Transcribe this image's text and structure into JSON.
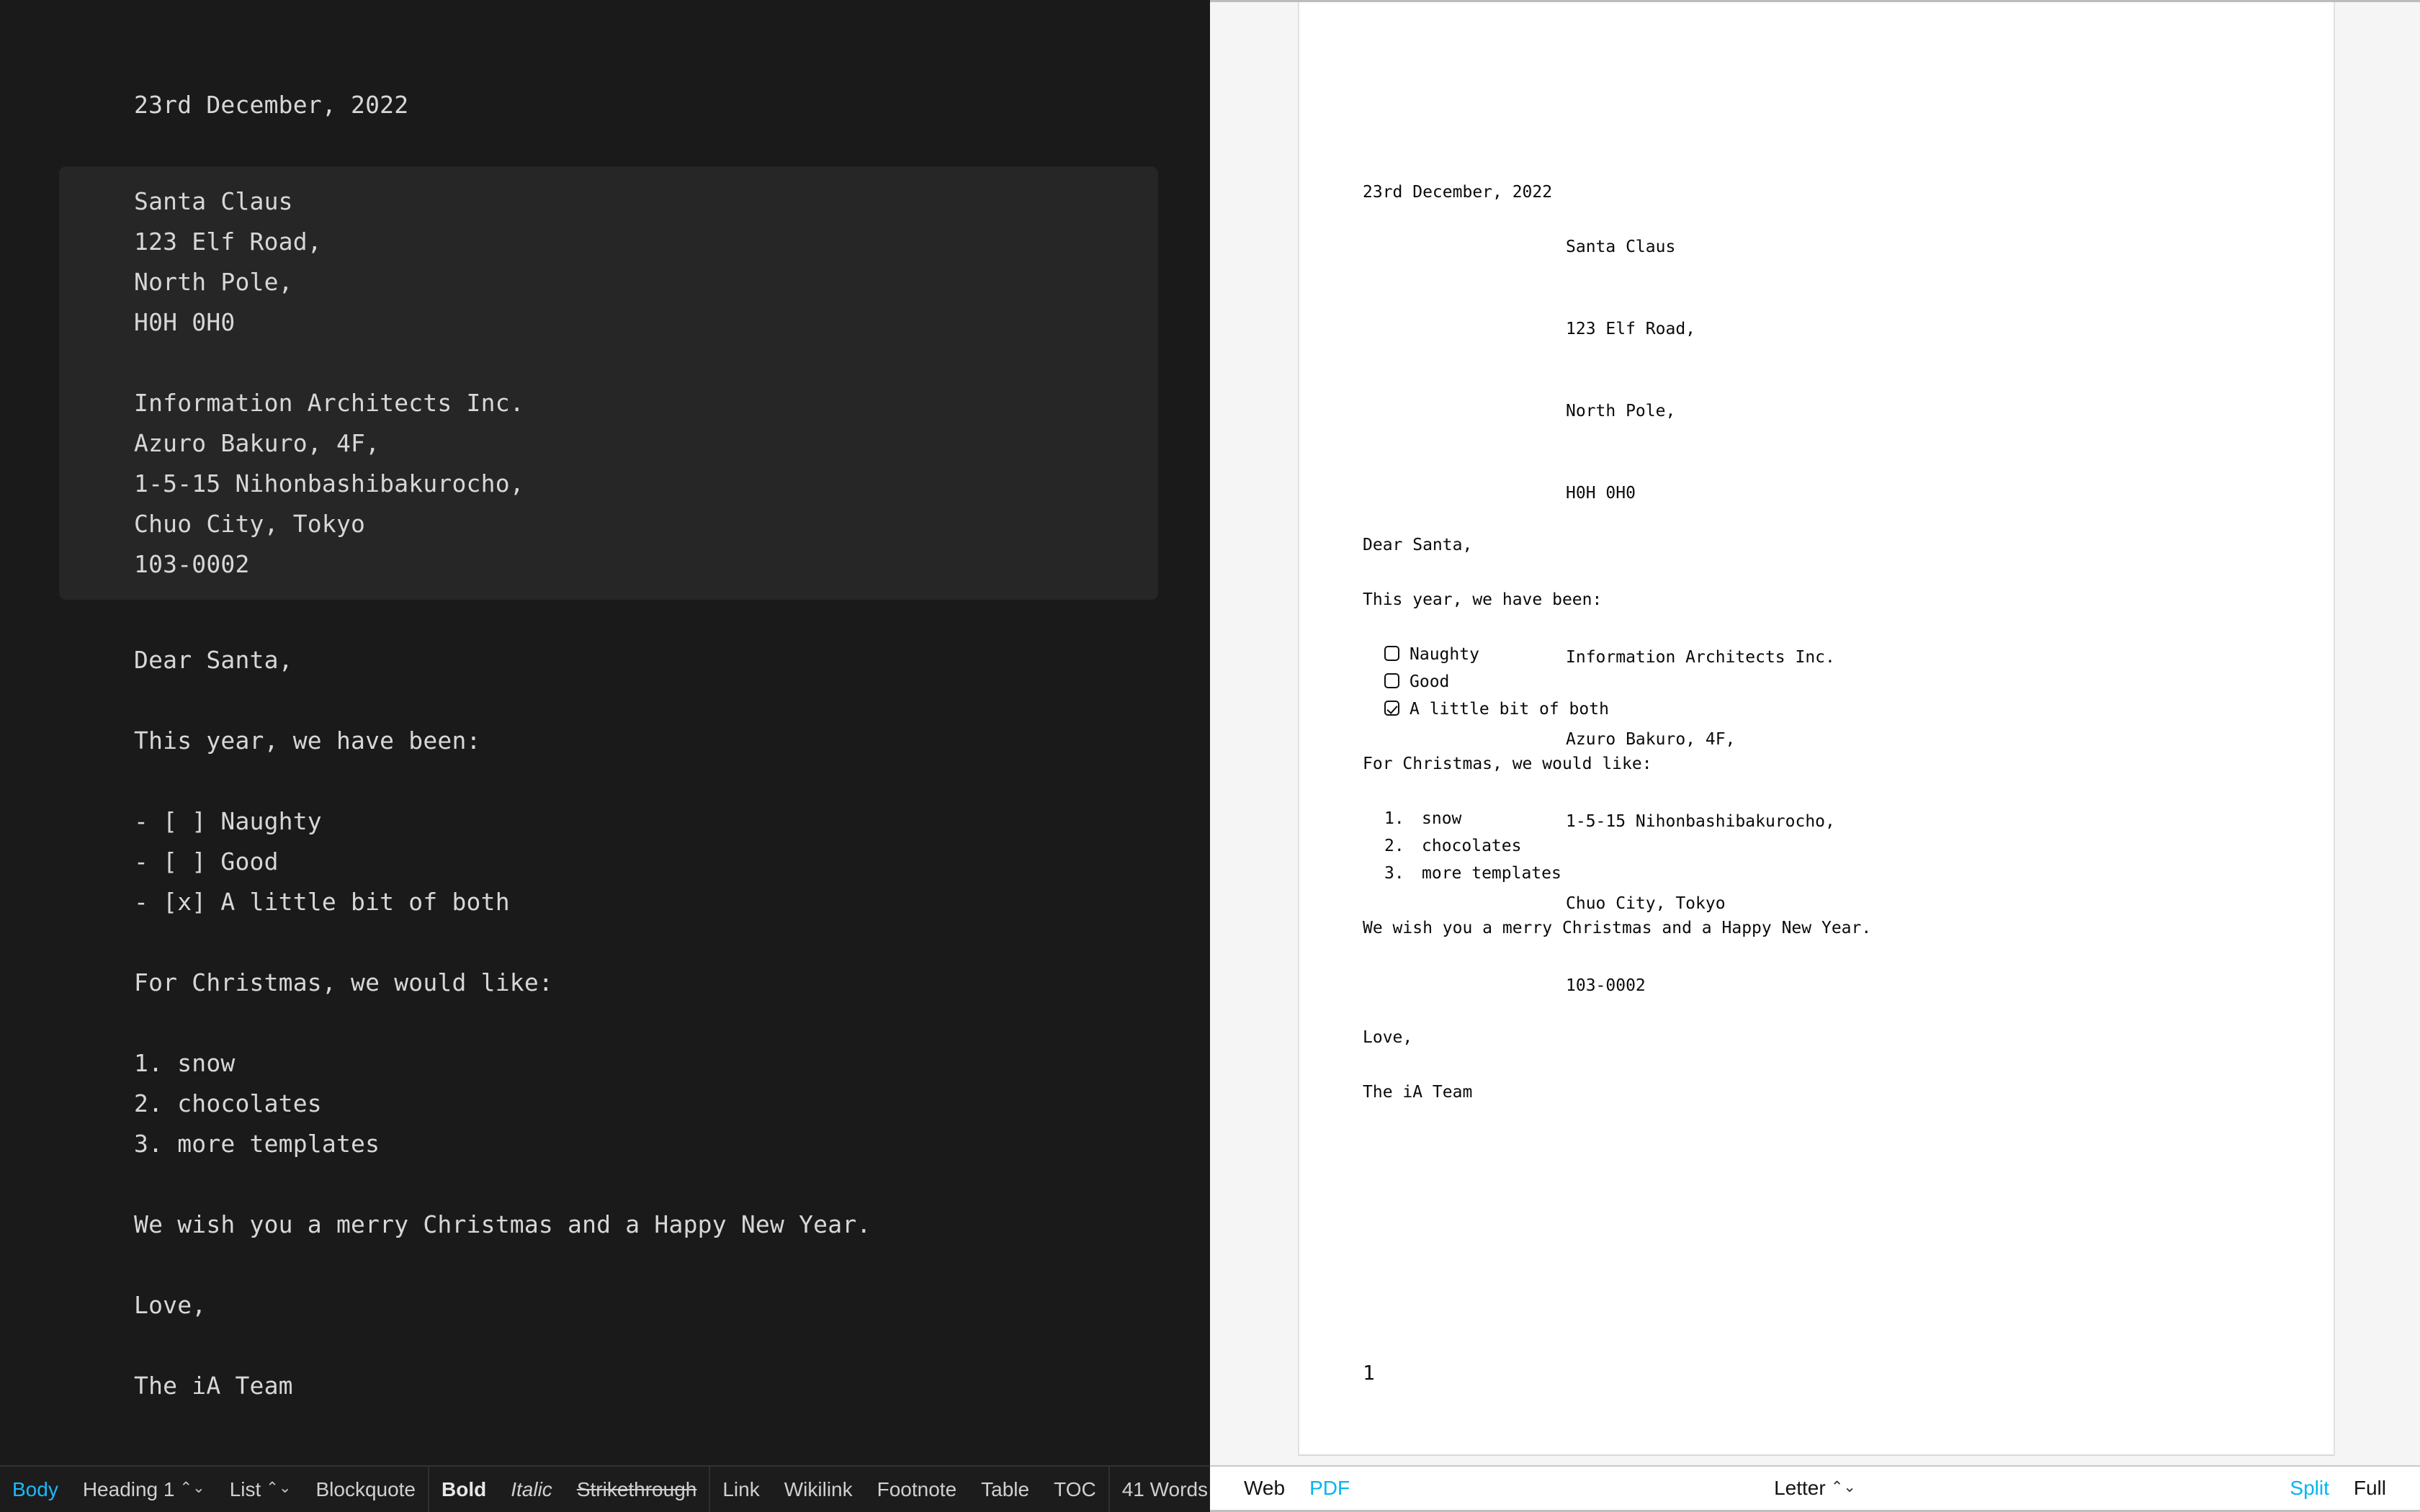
{
  "editor": {
    "date_line": "23rd December, 2022",
    "address_block": [
      "Santa Claus",
      "123 Elf Road,",
      "North Pole,",
      "H0H 0H0",
      "",
      "Information Architects Inc.",
      "Azuro Bakuro, 4F,",
      "1-5-15 Nihonbashibakurocho,",
      "Chuo City, Tokyo",
      "103-0002"
    ],
    "body_lines": [
      "Dear Santa,",
      "",
      "This year, we have been:",
      "",
      "- [ ] Naughty",
      "- [ ] Good",
      "- [x] A little bit of both",
      "",
      "For Christmas, we would like:",
      "",
      "1. snow",
      "2. chocolates",
      "3. more templates",
      "",
      "We wish you a merry Christmas and a Happy New Year.",
      "",
      "Love,",
      "",
      "The iA Team"
    ]
  },
  "preview": {
    "date_line": "23rd December, 2022",
    "address_lines": [
      "Santa Claus",
      "123 Elf Road,",
      "North Pole,",
      "H0H 0H0"
    ],
    "company_lines": [
      "Information Architects Inc.",
      "Azuro Bakuro, 4F,",
      "1-5-15 Nihonbashibakurocho,",
      "Chuo City, Tokyo",
      "103-0002"
    ],
    "salutation": "Dear Santa,",
    "intro": "This year, we have been:",
    "tasks": [
      {
        "label": "Naughty",
        "checked": false
      },
      {
        "label": "Good",
        "checked": false
      },
      {
        "label": "A little bit of both",
        "checked": true
      }
    ],
    "wishlist_intro": "For Christmas, we would like:",
    "wishlist": [
      {
        "num": "1.",
        "label": "snow"
      },
      {
        "num": "2.",
        "label": "chocolates"
      },
      {
        "num": "3.",
        "label": "more templates"
      }
    ],
    "closing_wish": "We wish you a merry Christmas and a Happy New Year.",
    "signoff": "Love,",
    "signature": "The iA Team",
    "page_number": "1"
  },
  "editor_toolbar": {
    "body": "Body",
    "heading": "Heading 1",
    "heading_stepper": "⌃⌄",
    "list": "List",
    "list_stepper": "⌃⌄",
    "blockquote": "Blockquote",
    "bold": "Bold",
    "italic": "Italic",
    "strikethrough": "Strikethrough",
    "link": "Link",
    "wikilink": "Wikilink",
    "footnote": "Footnote",
    "table": "Table",
    "toc": "TOC",
    "word_count": "41 Words",
    "word_count_stepper": "⌃⌄"
  },
  "preview_toolbar": {
    "web": "Web",
    "pdf": "PDF",
    "paper_size": "Letter",
    "paper_stepper": "⌃⌄",
    "split": "Split",
    "full": "Full"
  },
  "colors": {
    "accent": "#19b9ff",
    "preview_accent": "#00b5f0",
    "editor_bg": "#1a1a1a",
    "codeblock_bg": "#262626",
    "editor_text": "#d7d7d7"
  }
}
